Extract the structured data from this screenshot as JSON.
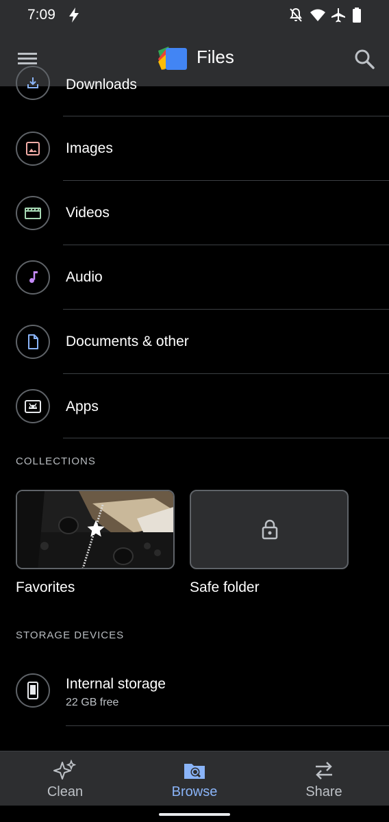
{
  "status_bar": {
    "time": "7:09",
    "icons": [
      "flash-icon",
      "bell-off-icon",
      "wifi-icon",
      "airplane-icon",
      "battery-icon"
    ]
  },
  "app_bar": {
    "title": "Files",
    "menu_icon": "hamburger-menu-icon",
    "logo_icon": "files-logo-icon",
    "search_icon": "search-icon"
  },
  "categories": [
    {
      "label": "Downloads",
      "icon": "download-icon",
      "icon_color": "#8ab4f8"
    },
    {
      "label": "Images",
      "icon": "image-icon",
      "icon_color": "#f6aea9"
    },
    {
      "label": "Videos",
      "icon": "movie-icon",
      "icon_color": "#a8dab5"
    },
    {
      "label": "Audio",
      "icon": "music-note-icon",
      "icon_color": "#c58af9"
    },
    {
      "label": "Documents & other",
      "icon": "document-icon",
      "icon_color": "#8ab4f8"
    },
    {
      "label": "Apps",
      "icon": "android-icon",
      "icon_color": "#e8eaed"
    }
  ],
  "collections": {
    "header": "COLLECTIONS",
    "items": [
      {
        "label": "Favorites",
        "icon": "star-icon"
      },
      {
        "label": "Safe folder",
        "icon": "lock-icon"
      }
    ]
  },
  "storage": {
    "header": "STORAGE DEVICES",
    "items": [
      {
        "label": "Internal storage",
        "detail": "22 GB free",
        "icon": "phone-icon"
      }
    ]
  },
  "bottom_nav": {
    "items": [
      {
        "label": "Clean",
        "icon": "sparkle-icon",
        "active": false
      },
      {
        "label": "Browse",
        "icon": "browse-folder-icon",
        "active": true
      },
      {
        "label": "Share",
        "icon": "swap-arrows-icon",
        "active": false
      }
    ]
  },
  "colors": {
    "bar_background": "#2d2e30",
    "accent": "#8ab4f8",
    "inactive_nav": "#bdc1c6",
    "divider": "#3c4043"
  }
}
